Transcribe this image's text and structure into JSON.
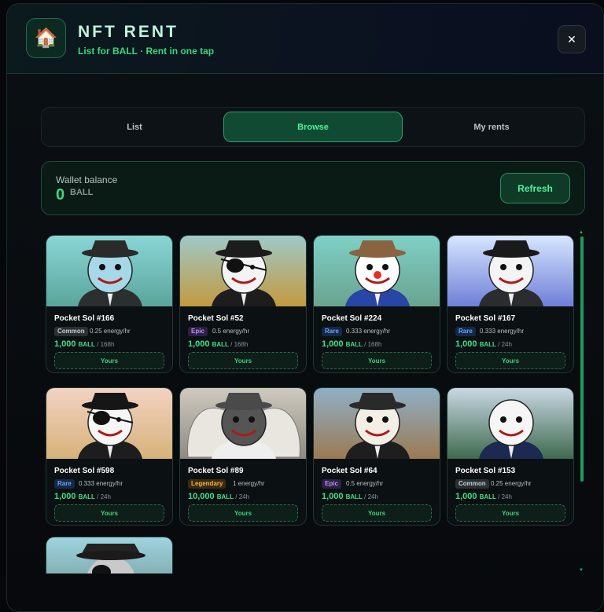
{
  "header": {
    "logo_emoji": "🏠",
    "title": "NFT RENT",
    "subtitle": "List for BALL · Rent in one tap",
    "close_label": "✕"
  },
  "tabs": [
    {
      "label": "List",
      "active": false
    },
    {
      "label": "Browse",
      "active": true
    },
    {
      "label": "My rents",
      "active": false
    }
  ],
  "wallet": {
    "label": "Wallet balance",
    "amount": "0",
    "unit": "BALL",
    "refresh_label": "Refresh"
  },
  "cards": [
    {
      "name": "Pocket Sol #166",
      "rarity": "Common",
      "energy": "0.25 energy/hr",
      "price": "1,000",
      "unit": "BALL",
      "duration": " / 168h",
      "action": "Yours"
    },
    {
      "name": "Pocket Sol #52",
      "rarity": "Epic",
      "energy": "0.5 energy/hr",
      "price": "1,000",
      "unit": "BALL",
      "duration": " / 168h",
      "action": "Yours"
    },
    {
      "name": "Pocket Sol #224",
      "rarity": "Rare",
      "energy": "0.333 energy/hr",
      "price": "1,000",
      "unit": "BALL",
      "duration": " / 168h",
      "action": "Yours"
    },
    {
      "name": "Pocket Sol #167",
      "rarity": "Rare",
      "energy": "0.333 energy/hr",
      "price": "1,000",
      "unit": "BALL",
      "duration": " / 24h",
      "action": "Yours"
    },
    {
      "name": "Pocket Sol #598",
      "rarity": "Rare",
      "energy": "0.333 energy/hr",
      "price": "1,000",
      "unit": "BALL",
      "duration": " / 24h",
      "action": "Yours"
    },
    {
      "name": "Pocket Sol #89",
      "rarity": "Legendary",
      "energy": "1 energy/hr",
      "price": "10,000",
      "unit": "BALL",
      "duration": " / 24h",
      "action": "Yours"
    },
    {
      "name": "Pocket Sol #64",
      "rarity": "Epic",
      "energy": "0.5 energy/hr",
      "price": "1,000",
      "unit": "BALL",
      "duration": " / 24h",
      "action": "Yours"
    },
    {
      "name": "Pocket Sol #153",
      "rarity": "Common",
      "energy": "0.25 energy/hr",
      "price": "1,000",
      "unit": "BALL",
      "duration": " / 24h",
      "action": "Yours"
    }
  ],
  "colors": {
    "accent": "#3fe08a",
    "common": "#c6cfd1",
    "epic": "#b692f5",
    "rare": "#69a4f2",
    "legendary": "#f4b640"
  }
}
